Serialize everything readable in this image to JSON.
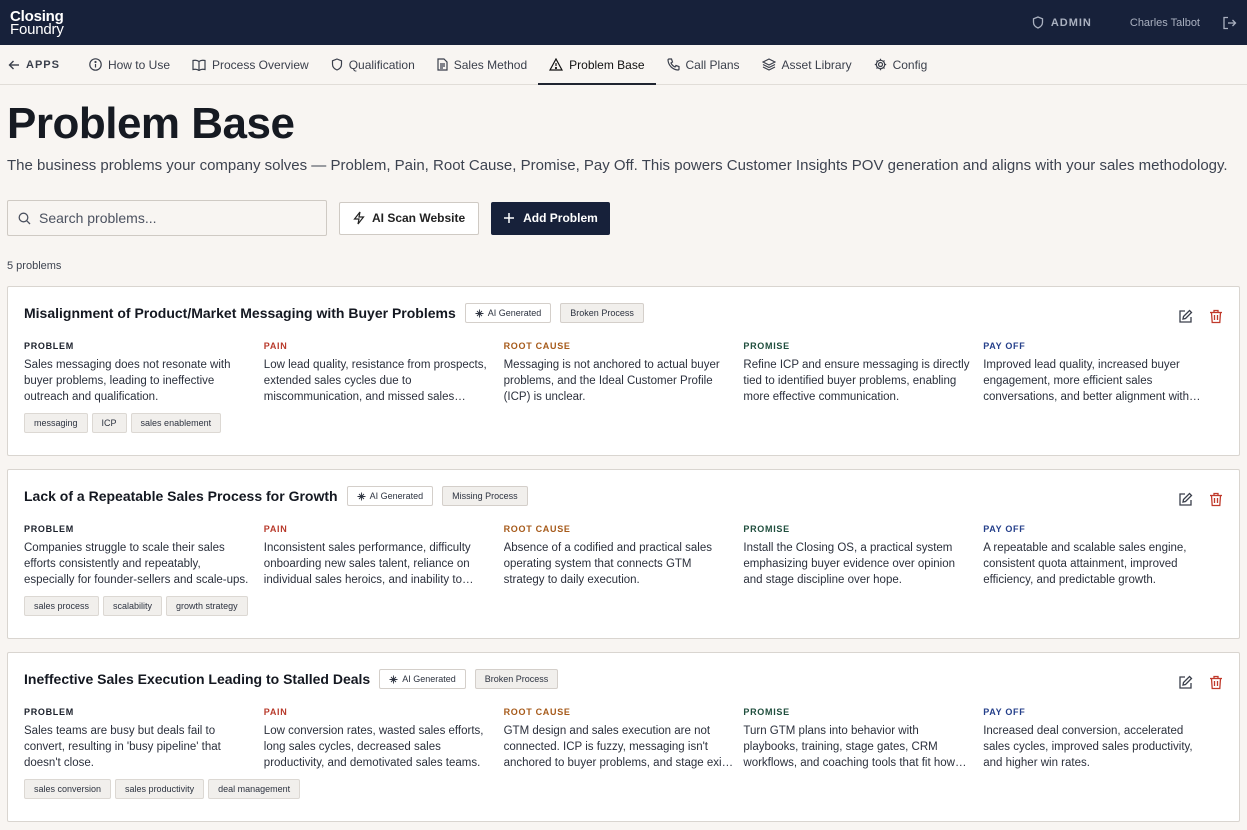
{
  "brand": {
    "line1": "Closing",
    "line2": "Foundry"
  },
  "topbar": {
    "admin_label": "ADMIN",
    "user_name": "Charles Talbot"
  },
  "nav": {
    "back_label": "APPS",
    "items": [
      {
        "label": "How to Use",
        "icon": "info-icon"
      },
      {
        "label": "Process Overview",
        "icon": "book-icon"
      },
      {
        "label": "Qualification",
        "icon": "shield-icon"
      },
      {
        "label": "Sales Method",
        "icon": "document-icon"
      },
      {
        "label": "Problem Base",
        "icon": "warning-icon",
        "active": true
      },
      {
        "label": "Call Plans",
        "icon": "phone-icon"
      },
      {
        "label": "Asset Library",
        "icon": "layers-icon"
      },
      {
        "label": "Config",
        "icon": "gear-icon"
      }
    ]
  },
  "page": {
    "title": "Problem Base",
    "subtitle": "The business problems your company solves — Problem, Pain, Root Cause, Promise, Pay Off. This powers Customer Insights POV generation and aligns with your sales methodology.",
    "search_placeholder": "Search problems...",
    "ai_scan_label": "AI Scan Website",
    "add_label": "Add Problem",
    "count_text": "5 problems"
  },
  "column_labels": {
    "problem": "PROBLEM",
    "pain": "PAIN",
    "root_cause": "ROOT CAUSE",
    "promise": "PROMISE",
    "pay_off": "PAY OFF"
  },
  "problems": [
    {
      "title": "Misalignment of Product/Market Messaging with Buyer Problems",
      "ai_badge": "AI Generated",
      "type_badge": "Broken Process",
      "problem": "Sales messaging does not resonate with buyer problems, leading to ineffective outreach and qualification.",
      "pain": "Low lead quality, resistance from prospects, extended sales cycles due to miscommunication, and missed sales opportunities.",
      "root_cause": "Messaging is not anchored to actual buyer problems, and the Ideal Customer Profile (ICP) is unclear.",
      "promise": "Refine ICP and ensure messaging is directly tied to identified buyer problems, enabling more effective communication.",
      "pay_off": "Improved lead quality, increased buyer engagement, more efficient sales conversations, and better alignment with buyers.",
      "tags": [
        "messaging",
        "ICP",
        "sales enablement"
      ]
    },
    {
      "title": "Lack of a Repeatable Sales Process for Growth",
      "ai_badge": "AI Generated",
      "type_badge": "Missing Process",
      "problem": "Companies struggle to scale their sales efforts consistently and repeatably, especially for founder-sellers and scale-ups.",
      "pain": "Inconsistent sales performance, difficulty onboarding new sales talent, reliance on individual sales heroics, and inability to forecast.",
      "root_cause": "Absence of a codified and practical sales operating system that connects GTM strategy to daily execution.",
      "promise": "Install the Closing OS, a practical system emphasizing buyer evidence over opinion and stage discipline over hope.",
      "pay_off": "A repeatable and scalable sales engine, consistent quota attainment, improved efficiency, and predictable growth.",
      "tags": [
        "sales process",
        "scalability",
        "growth strategy"
      ]
    },
    {
      "title": "Ineffective Sales Execution Leading to Stalled Deals",
      "ai_badge": "AI Generated",
      "type_badge": "Broken Process",
      "problem": "Sales teams are busy but deals fail to convert, resulting in 'busy pipeline' that doesn't close.",
      "pain": "Low conversion rates, wasted sales efforts, long sales cycles, decreased sales productivity, and demotivated sales teams.",
      "root_cause": "GTM design and sales execution are not connected. ICP is fuzzy, messaging isn't anchored to buyer problems, and stage exits are unclear.",
      "promise": "Turn GTM plans into behavior with playbooks, training, stage gates, CRM workflows, and coaching tools that fit how teams sell.",
      "pay_off": "Increased deal conversion, accelerated sales cycles, improved sales productivity, and higher win rates.",
      "tags": [
        "sales conversion",
        "sales productivity",
        "deal management"
      ]
    }
  ]
}
